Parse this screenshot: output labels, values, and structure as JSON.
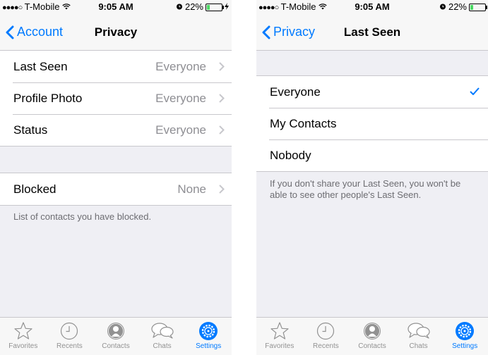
{
  "status_bar": {
    "signal": "●●●●○",
    "carrier": "T-Mobile",
    "time": "9:05 AM",
    "battery": "22%",
    "battery_level": 0.22
  },
  "left": {
    "nav": {
      "back_label": "Account",
      "title": "Privacy"
    },
    "rows": [
      {
        "label": "Last Seen",
        "value": "Everyone"
      },
      {
        "label": "Profile Photo",
        "value": "Everyone"
      },
      {
        "label": "Status",
        "value": "Everyone"
      }
    ],
    "blocked": {
      "label": "Blocked",
      "value": "None"
    },
    "blocked_footer": "List of contacts you have blocked."
  },
  "right": {
    "nav": {
      "back_label": "Privacy",
      "title": "Last Seen"
    },
    "options": [
      {
        "label": "Everyone",
        "selected": true
      },
      {
        "label": "My Contacts",
        "selected": false
      },
      {
        "label": "Nobody",
        "selected": false
      }
    ],
    "footer": "If you don't share your Last Seen, you won't be able to see other people's Last Seen."
  },
  "tab_bar": {
    "items": [
      {
        "label": "Favorites",
        "icon": "star-icon"
      },
      {
        "label": "Recents",
        "icon": "clock-icon"
      },
      {
        "label": "Contacts",
        "icon": "person-icon"
      },
      {
        "label": "Chats",
        "icon": "chat-bubbles-icon"
      },
      {
        "label": "Settings",
        "icon": "gear-icon"
      }
    ],
    "active": "Settings"
  },
  "colors": {
    "accent": "#007aff",
    "background": "#efeff4",
    "secondary_text": "#8e8e93",
    "battery_fill": "#4cd964"
  }
}
